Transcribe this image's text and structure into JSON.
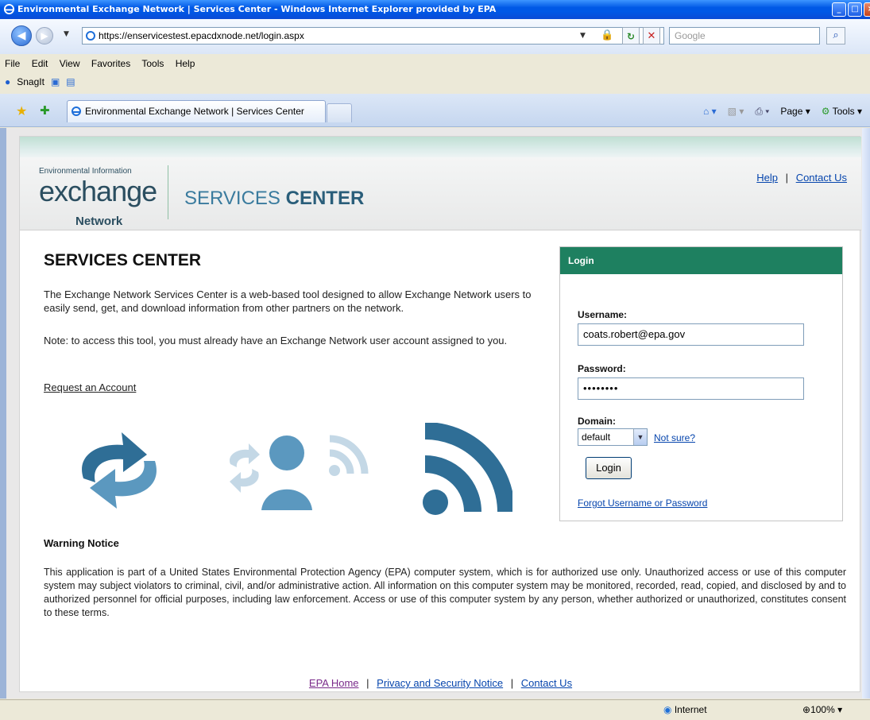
{
  "window": {
    "title": "Environmental Exchange Network | Services Center - Windows Internet Explorer provided by EPA",
    "url": "https://enservicestest.epacdxnode.net/login.aspx",
    "search_placeholder": "Google"
  },
  "menu": [
    "File",
    "Edit",
    "View",
    "Favorites",
    "Tools",
    "Help"
  ],
  "toolbar": {
    "snagit": "SnagIt"
  },
  "tab": {
    "title": "Environmental Exchange Network | Services Center"
  },
  "commands": {
    "page": "Page",
    "tools": "Tools"
  },
  "header": {
    "logo_small": "Environmental Information",
    "logo_main": "exchange",
    "logo_net": "Network",
    "title_light": "SERVICES ",
    "title_bold": "CENTER",
    "help": "Help",
    "contact": "Contact Us"
  },
  "main": {
    "heading": "SERVICES CENTER",
    "intro": "The Exchange Network Services Center is a web-based tool designed to allow Exchange Network users to easily send, get, and download information from other partners on the network.",
    "note": "Note: to access this tool, you must already have an Exchange Network user account assigned to you.",
    "request_link": "Request an Account"
  },
  "login": {
    "header": "Login",
    "username_label": "Username:",
    "username_value": "coats.robert@epa.gov",
    "password_label": "Password:",
    "password_value": "••••••••",
    "domain_label": "Domain:",
    "domain_value": "default",
    "not_sure": "Not sure?",
    "login_button": "Login",
    "forgot": "Forgot Username or Password"
  },
  "warning": {
    "heading": "Warning Notice",
    "text": "This application is part of a United States Environmental Protection Agency (EPA) computer system, which is for authorized use only. Unauthorized access or use of this computer system may subject violators to criminal, civil, and/or administrative action. All information on this computer system may be monitored, recorded, read, copied, and disclosed by and to authorized personnel for official purposes, including law enforcement. Access or use of this computer system by any person, whether authorized or unauthorized, constitutes consent to these terms."
  },
  "footer": {
    "epa_home": "EPA Home",
    "privacy": "Privacy and Security Notice",
    "contact": "Contact Us"
  },
  "status": {
    "zone": "Internet",
    "zoom": "100%"
  },
  "colors": {
    "login_header": "#1e8060",
    "brand_blue": "#3a7b9e",
    "link": "#0645ad"
  }
}
